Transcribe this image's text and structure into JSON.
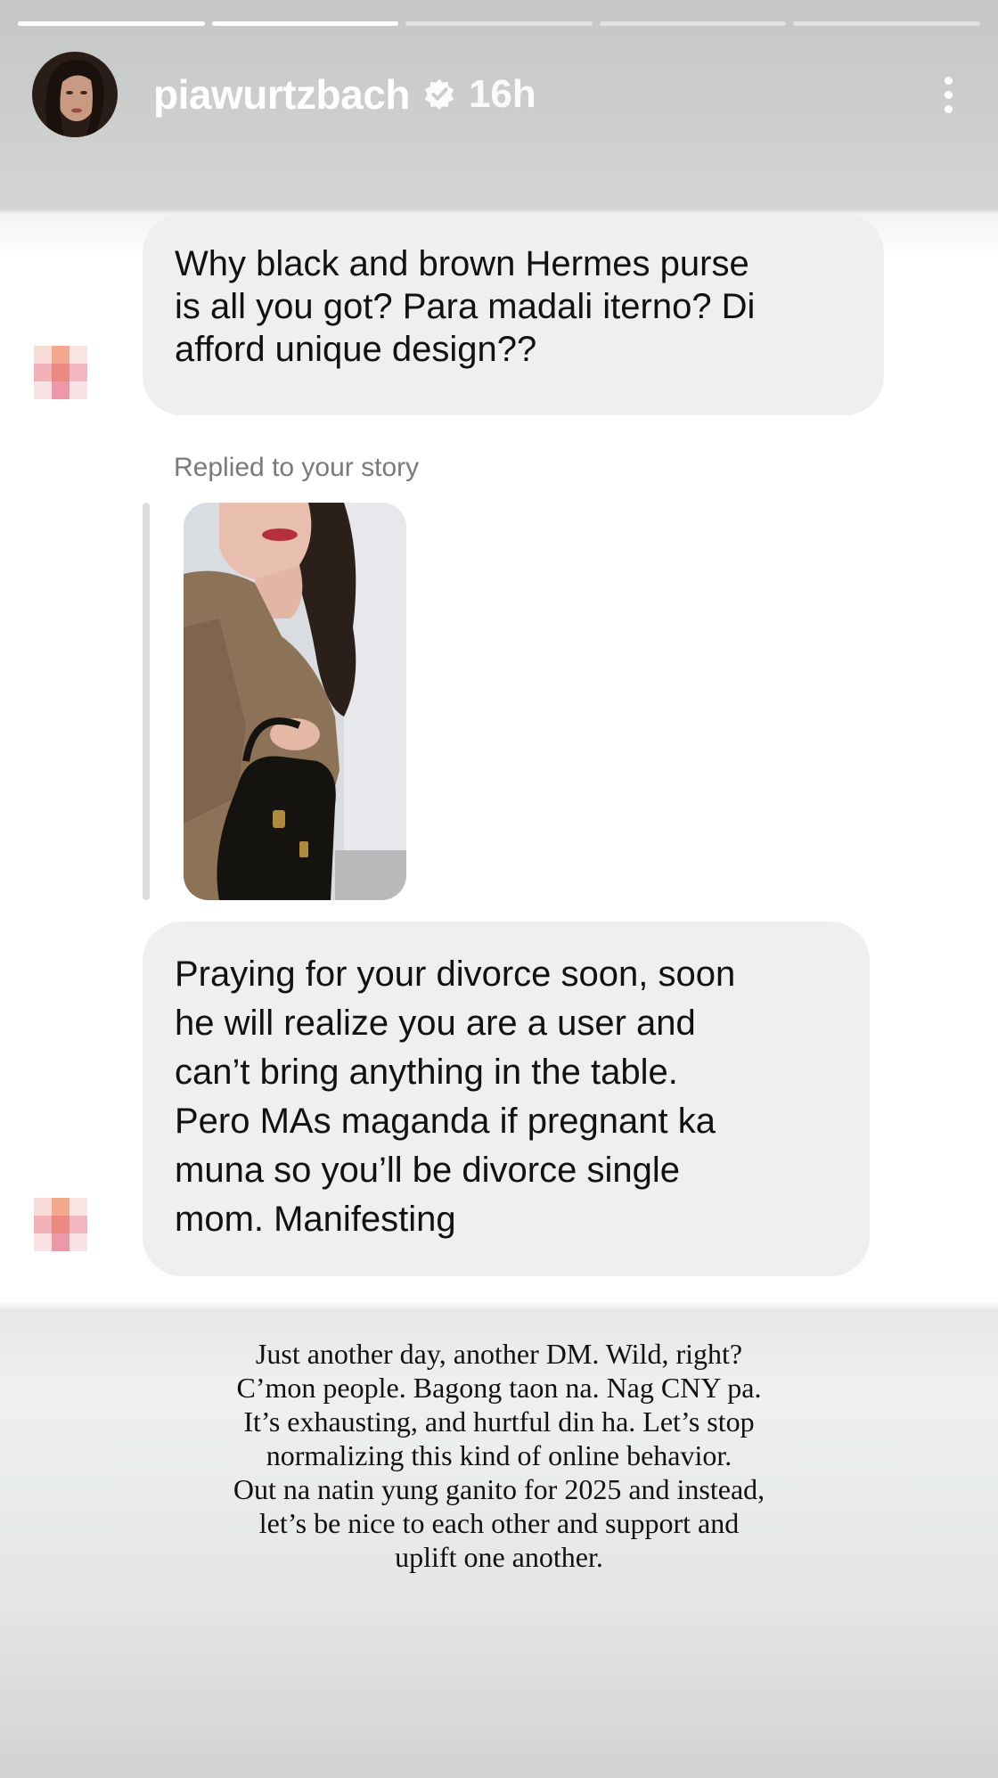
{
  "story": {
    "segments": [
      {
        "progress": 1.0
      },
      {
        "progress": 1.0
      },
      {
        "progress": 0.0
      },
      {
        "progress": 0.0
      },
      {
        "progress": 0.0
      }
    ],
    "header": {
      "username": "piawurtzbach",
      "time": "16h",
      "verified": true
    },
    "messages": [
      {
        "lines": [
          "Why black and brown Hermes purse",
          "is all you got? Para madali iterno? Di",
          "afford unique design??"
        ]
      },
      {
        "lines": [
          "Praying for your divorce soon, soon",
          "he will realize you are a user and",
          "can’t bring anything in the table.",
          "Pero MAs maganda if pregnant ka",
          "muna so you’ll be divorce single",
          "mom. Manifesting"
        ]
      }
    ],
    "reply_label": "Replied to your story",
    "caption_lines": [
      "Just another day, another DM. Wild, right?",
      "C’mon people. Bagong taon na. Nag CNY pa.",
      "It’s exhausting, and hurtful din ha. Let’s stop",
      "normalizing this kind of online behavior.",
      "Out na natin yung ganito for 2025 and instead,",
      "let’s be nice to each other and support and",
      "uplift one another."
    ],
    "colors": {
      "bubble": "#efefef",
      "header_text": "#ffffff",
      "reply_label": "#7a7a7a"
    },
    "icons": [
      "verified-badge-icon",
      "more-options-icon"
    ]
  }
}
